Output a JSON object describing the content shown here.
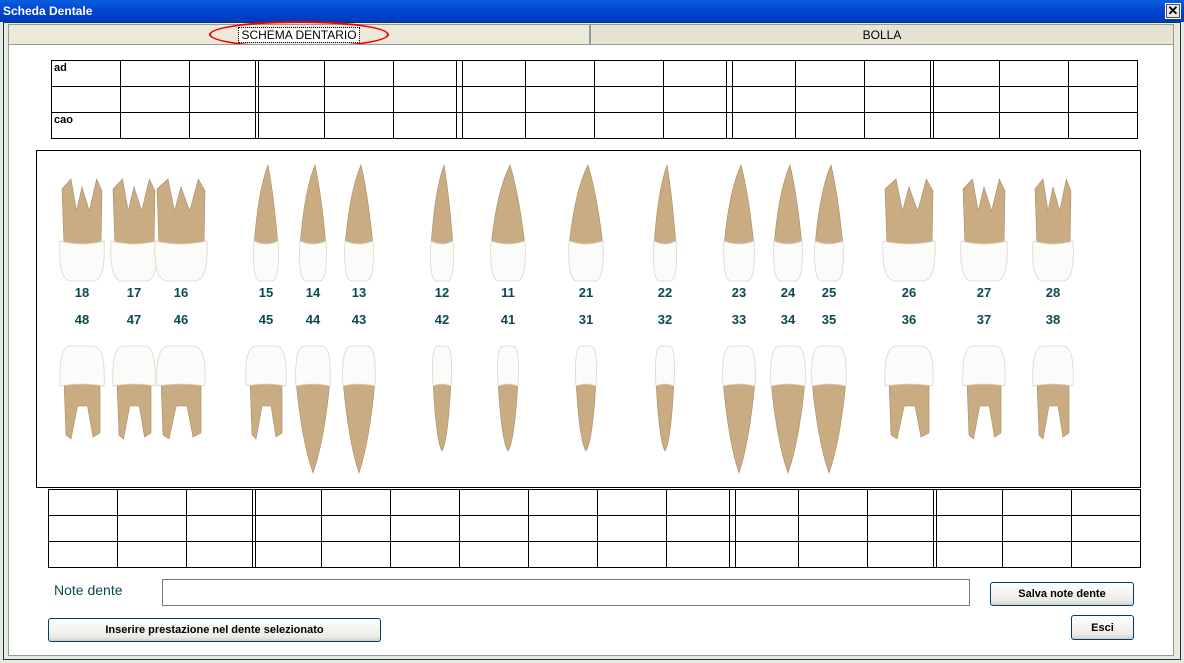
{
  "window": {
    "title": "Scheda Dentale",
    "close_symbol": "✕"
  },
  "tabs": [
    {
      "label": "SCHEMA DENTARIO"
    },
    {
      "label": "BOLLA"
    }
  ],
  "top_grid": {
    "row_labels": [
      "ad",
      "",
      "cao"
    ]
  },
  "teeth": {
    "upper_numbers": [
      "18",
      "17",
      "16",
      "15",
      "14",
      "13",
      "12",
      "11",
      "21",
      "22",
      "23",
      "24",
      "25",
      "26",
      "27",
      "28"
    ],
    "lower_numbers": [
      "48",
      "47",
      "46",
      "45",
      "44",
      "43",
      "42",
      "41",
      "31",
      "32",
      "33",
      "34",
      "35",
      "36",
      "37",
      "38"
    ],
    "colors": {
      "root": "#c9ac82",
      "crown": "#fbfbf9",
      "number": "#0d4a4f"
    }
  },
  "notes": {
    "label": "Note dente",
    "value": "",
    "save_label": "Salva note dente"
  },
  "actions": {
    "insert_label": "Inserire prestazione nel dente selezionato",
    "exit_label": "Esci"
  }
}
